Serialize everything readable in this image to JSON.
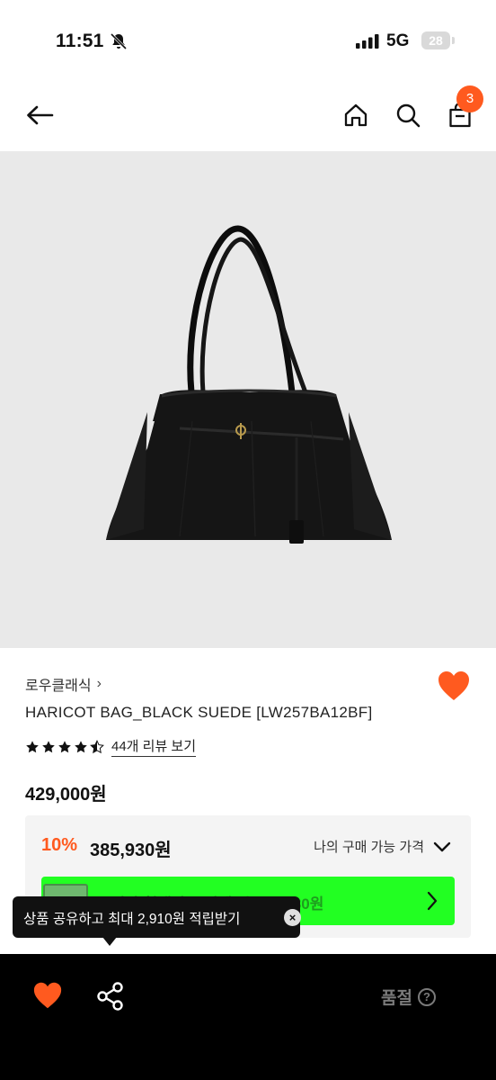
{
  "status_bar": {
    "time": "11:51",
    "network": "5G",
    "battery": "28"
  },
  "header": {
    "cart_count": "3"
  },
  "product": {
    "brand": "로우클래식",
    "brand_chevron": "›",
    "title": "HARICOT BAG_BLACK SUEDE [LW257BA12BF]",
    "rating": 4.5,
    "review_link": "44개 리뷰 보기",
    "price": "429,000원"
  },
  "discount": {
    "rate": "10%",
    "price": "385,930원",
    "my_price_label": "나의 구매 가능 가격",
    "card_banner_text": "무신사 현대카드 결제 시 355,930원"
  },
  "tooltip": {
    "text": "상품 공유하고 최대 2,910원 적립받기",
    "close": "×"
  },
  "bottom_bar": {
    "status_label": "품절",
    "help": "?"
  },
  "colors": {
    "accent": "#ff5a1f",
    "banner": "#22ff22",
    "bottom_bar": "#000000",
    "image_bg": "#e9e9e9"
  }
}
